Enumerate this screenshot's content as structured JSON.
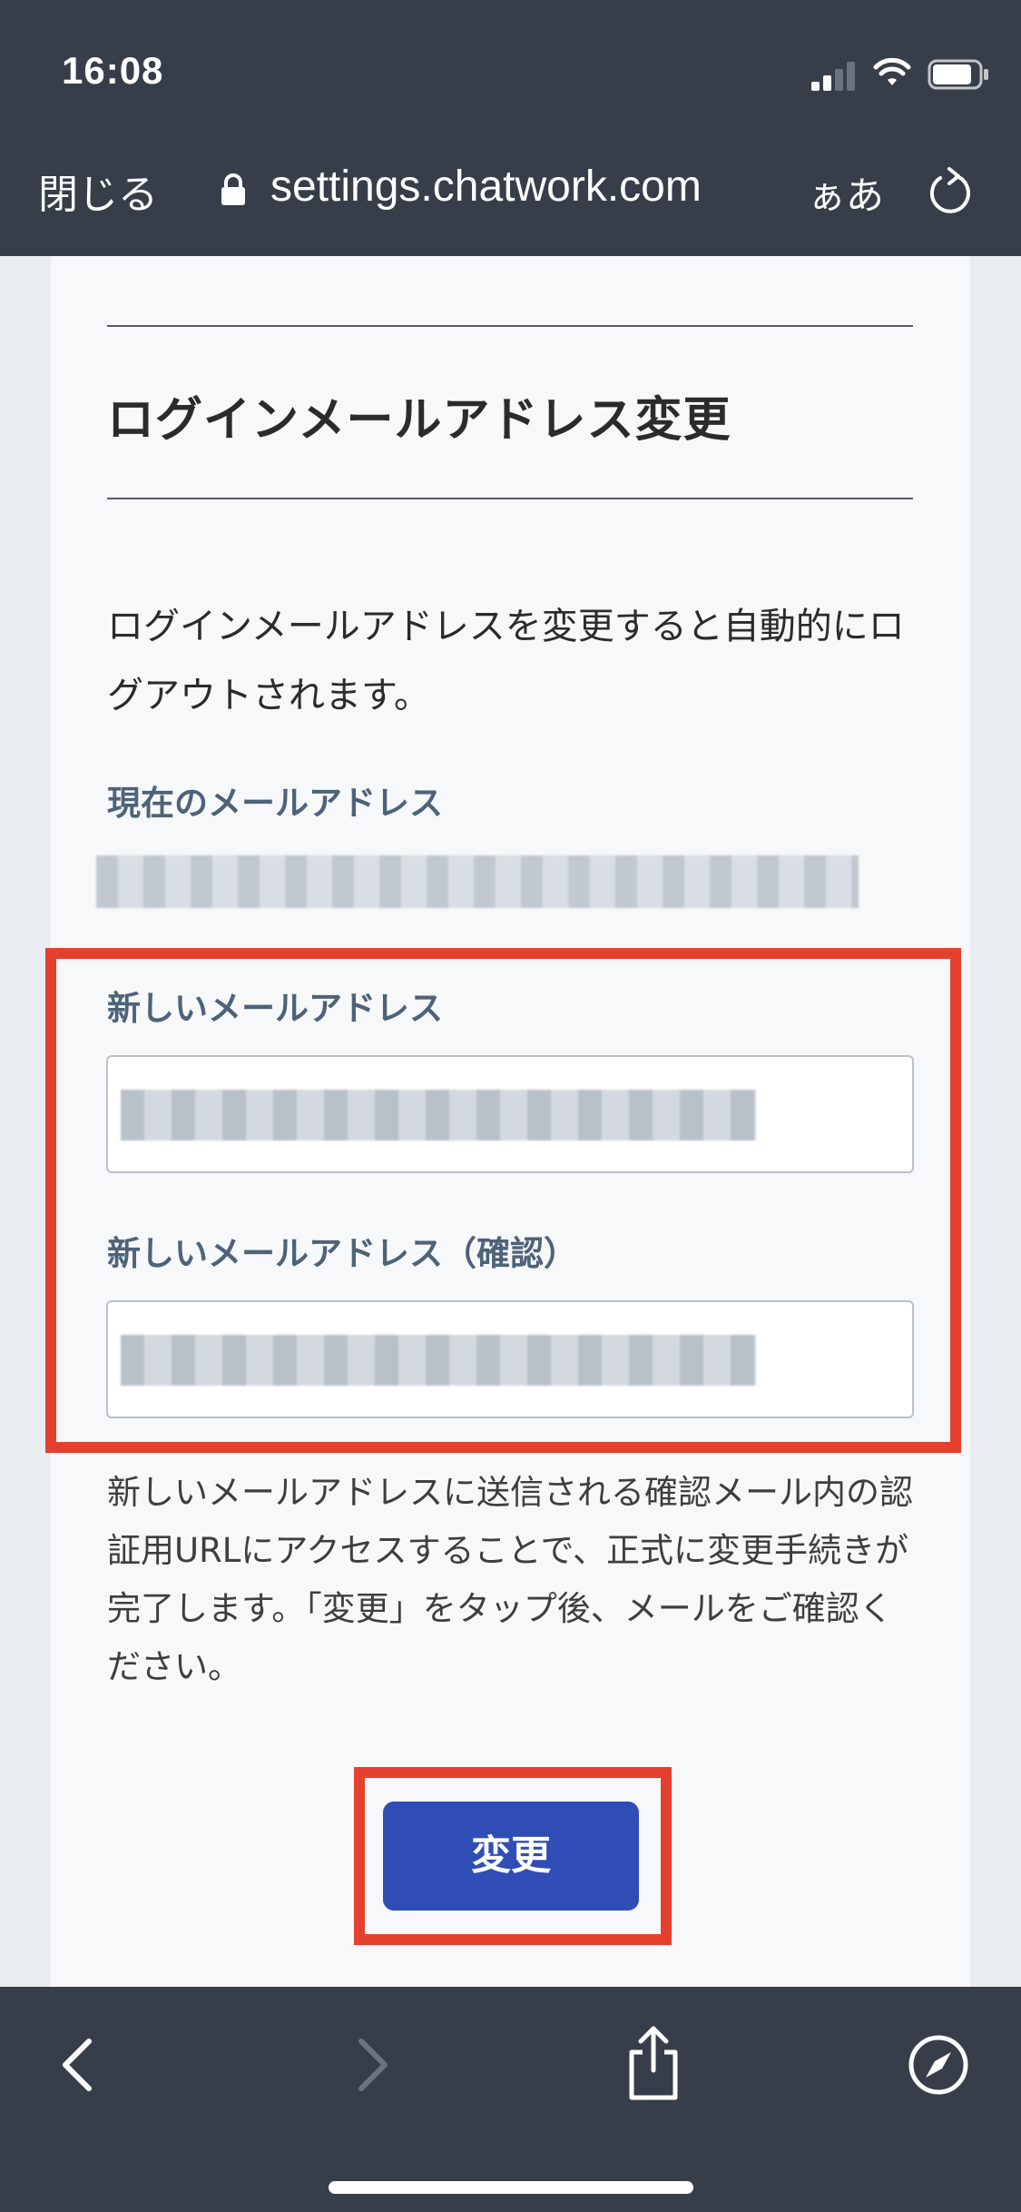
{
  "status_bar": {
    "time": "16:08"
  },
  "browser": {
    "close_label": "閉じる",
    "url": "settings.chatwork.com",
    "text_size_label": "ぁあ"
  },
  "page": {
    "title": "ログインメールアドレス変更",
    "intro": "ログインメールアドレスを変更すると自動的にログアウトされます。",
    "current_email_label": "現在のメールアドレス",
    "new_email_label": "新しいメールアドレス",
    "confirm_email_label": "新しいメールアドレス（確認）",
    "note": "新しいメールアドレスに送信される確認メール内の認証用URLにアクセスすることで、正式に変更手続きが完了します。「変更」をタップ後、メールをご確認ください。",
    "submit_label": "変更"
  },
  "colors": {
    "chrome": "#373e4a",
    "accent_button": "#2f4db5",
    "highlight_box": "#e5402e",
    "label": "#4e6278"
  },
  "icons": {
    "status": [
      "signal-icon",
      "wifi-icon",
      "battery-icon"
    ],
    "address_bar": [
      "lock-icon",
      "reload-icon"
    ],
    "toolbar": [
      "back-icon",
      "forward-icon",
      "share-icon",
      "safari-compass-icon"
    ]
  }
}
